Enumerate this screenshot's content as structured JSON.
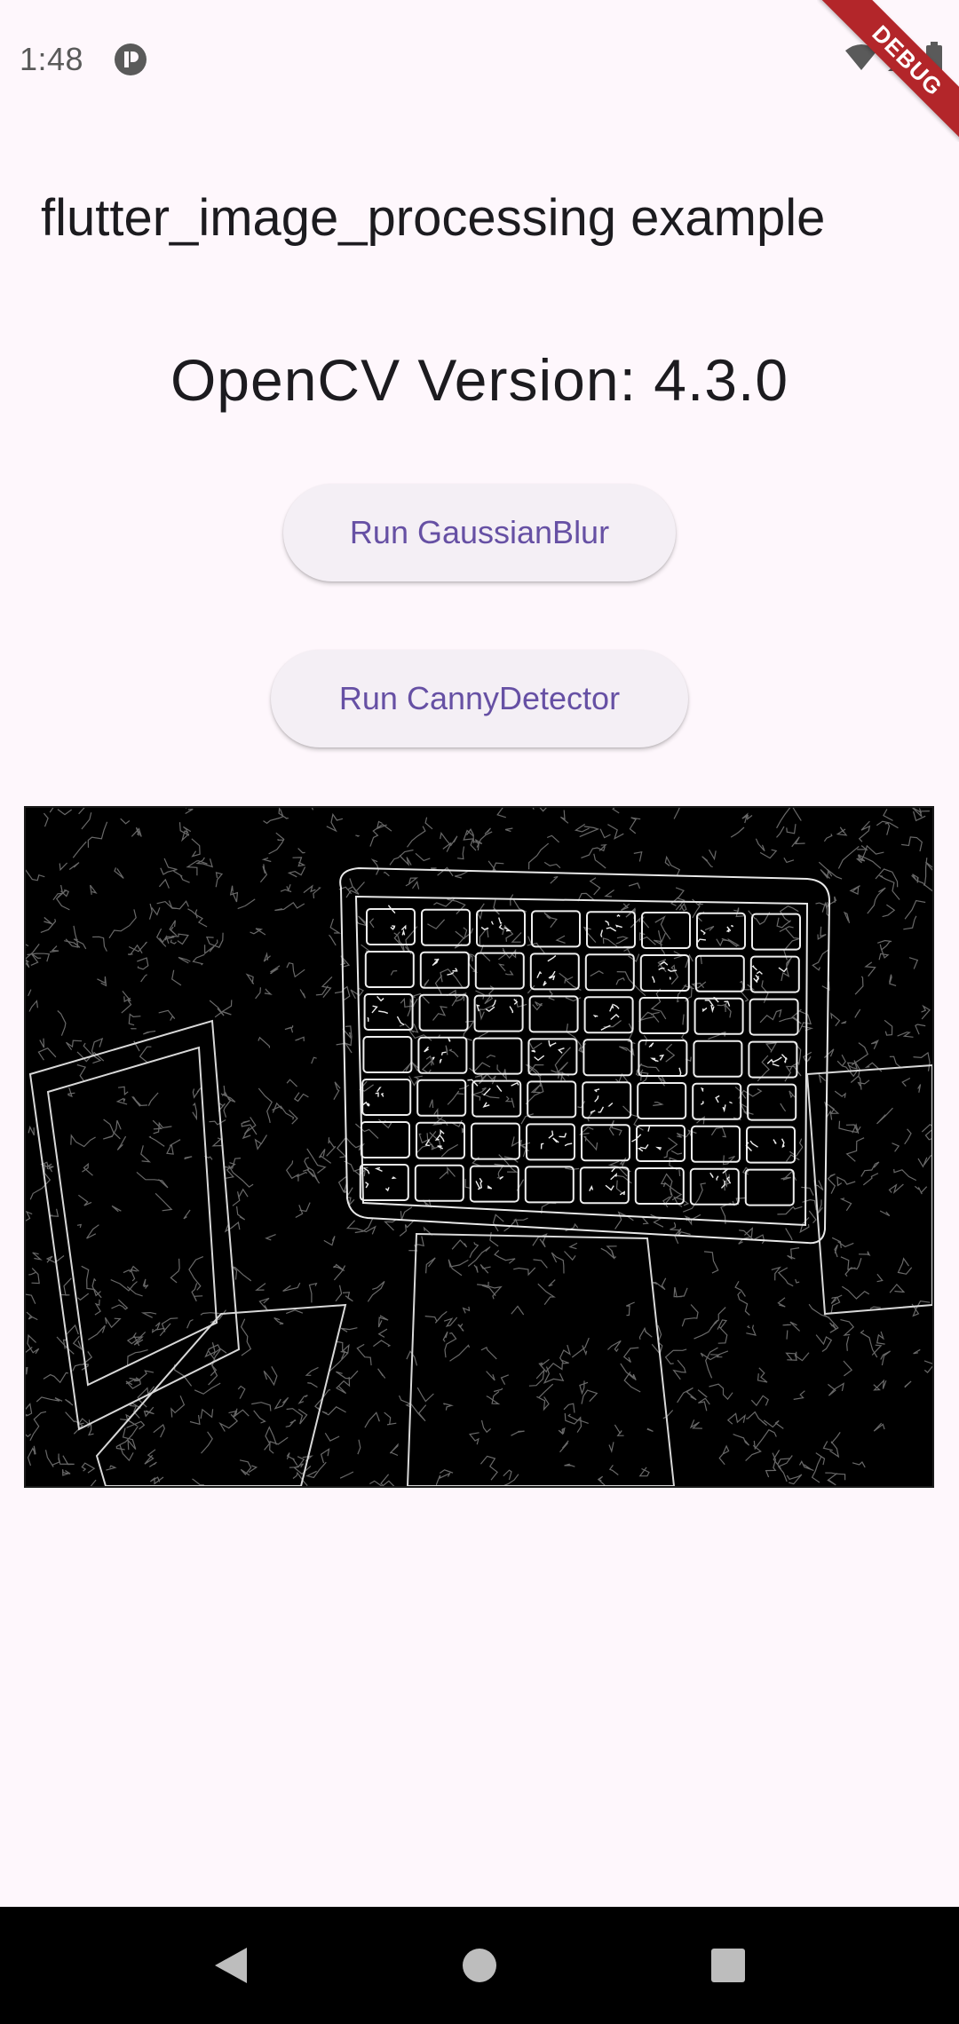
{
  "status_bar": {
    "time": "1:48",
    "icons": [
      "app-notification-icon",
      "wifi-icon",
      "signal-icon",
      "battery-icon"
    ]
  },
  "debug_banner": {
    "label": "DEBUG",
    "color": "#b3262a"
  },
  "app": {
    "title": "flutter_image_processing example",
    "version_text": "OpenCV Version: 4.3.0"
  },
  "buttons": {
    "gaussian_label": "Run GaussianBlur",
    "canny_label": "Run CannyDetector"
  },
  "result_image": {
    "description_icon": "canny-edge-output-image"
  },
  "nav_bar": {
    "icons": [
      "back-icon",
      "home-icon",
      "recents-icon"
    ]
  },
  "colors": {
    "background": "#fef7fc",
    "button_text": "#6650a4",
    "button_bg": "#f4eff5",
    "title_text": "#1c1b1f"
  }
}
